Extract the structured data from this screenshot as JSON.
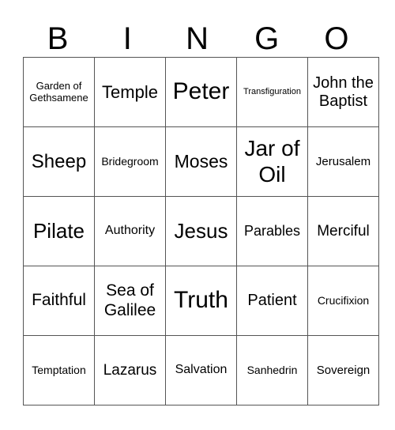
{
  "header": {
    "letters": [
      "B",
      "I",
      "N",
      "G",
      "O"
    ]
  },
  "grid": [
    [
      "Garden of Gethsamene",
      "Temple",
      "Peter",
      "Transfiguration",
      "John the Baptist"
    ],
    [
      "Sheep",
      "Bridegroom",
      "Moses",
      "Jar of Oil",
      "Jerusalem"
    ],
    [
      "Pilate",
      "Authority",
      "Jesus",
      "Parables",
      "Merciful"
    ],
    [
      "Faithful",
      "Sea of Galilee",
      "Truth",
      "Patient",
      "Crucifixion"
    ],
    [
      "Temptation",
      "Lazarus",
      "Salvation",
      "Sanhedrin",
      "Sovereign"
    ]
  ]
}
